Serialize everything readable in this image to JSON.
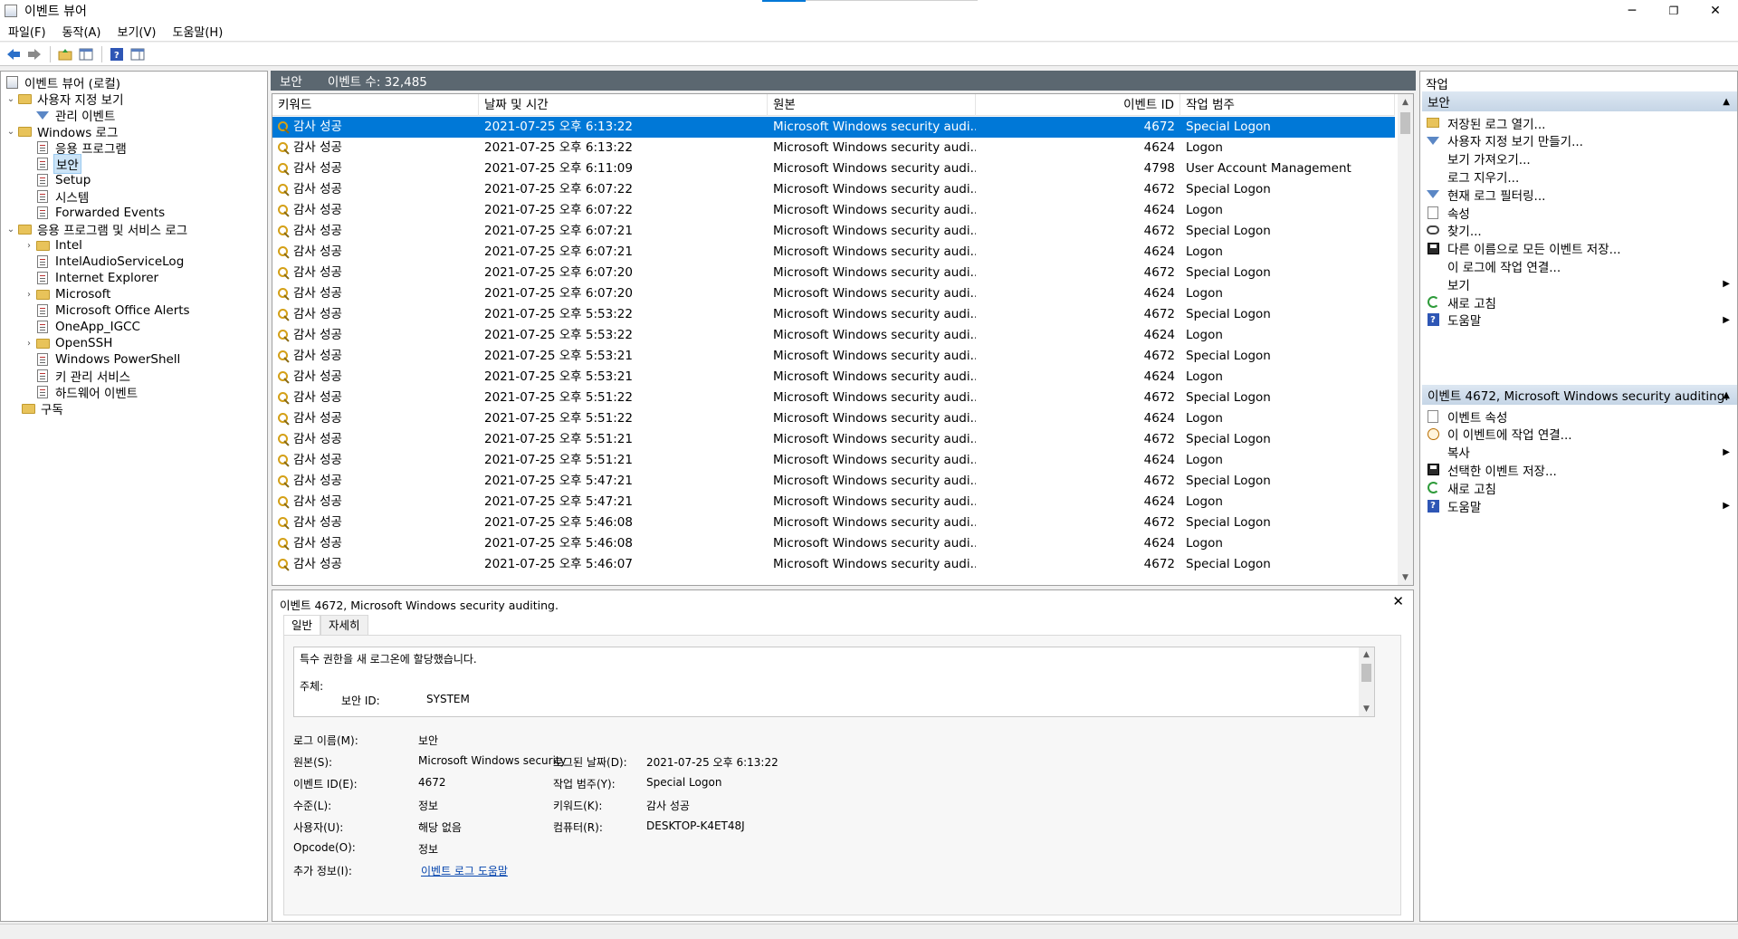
{
  "window": {
    "title": "이벤트 뷰어",
    "minimize": "─",
    "restore": "❐",
    "close": "✕"
  },
  "menu": [
    "파일(F)",
    "동작(A)",
    "보기(V)",
    "도움말(H)"
  ],
  "tree": {
    "root": "이벤트 뷰어 (로컬)",
    "custom_views": "사용자 지정 보기",
    "admin_events": "관리 이벤트",
    "windows_logs": "Windows 로그",
    "application": "응용 프로그램",
    "security": "보안",
    "setup": "Setup",
    "system": "시스템",
    "forwarded": "Forwarded Events",
    "app_service_logs": "응용 프로그램 및 서비스 로그",
    "intel": "Intel",
    "intel_audio": "IntelAudioServiceLog",
    "ie": "Internet Explorer",
    "microsoft": "Microsoft",
    "office_alerts": "Microsoft Office Alerts",
    "oneapp": "OneApp_IGCC",
    "openssh": "OpenSSH",
    "powershell": "Windows PowerShell",
    "key_mgmt": "키 관리 서비스",
    "hardware": "하드웨어 이벤트",
    "subscriptions": "구독"
  },
  "center": {
    "log_name": "보안",
    "event_count": "이벤트 수: 32,485"
  },
  "columns": {
    "keyword": "키워드",
    "datetime": "날짜 및 시간",
    "source": "원본",
    "event_id": "이벤트 ID",
    "category": "작업 범주"
  },
  "events": [
    {
      "kw": "감사 성공",
      "dt": "2021-07-25 오후 6:13:22",
      "src": "Microsoft Windows security audi...",
      "id": "4672",
      "cat": "Special Logon"
    },
    {
      "kw": "감사 성공",
      "dt": "2021-07-25 오후 6:13:22",
      "src": "Microsoft Windows security audi...",
      "id": "4624",
      "cat": "Logon"
    },
    {
      "kw": "감사 성공",
      "dt": "2021-07-25 오후 6:11:09",
      "src": "Microsoft Windows security audi...",
      "id": "4798",
      "cat": "User Account Management"
    },
    {
      "kw": "감사 성공",
      "dt": "2021-07-25 오후 6:07:22",
      "src": "Microsoft Windows security audi...",
      "id": "4672",
      "cat": "Special Logon"
    },
    {
      "kw": "감사 성공",
      "dt": "2021-07-25 오후 6:07:22",
      "src": "Microsoft Windows security audi...",
      "id": "4624",
      "cat": "Logon"
    },
    {
      "kw": "감사 성공",
      "dt": "2021-07-25 오후 6:07:21",
      "src": "Microsoft Windows security audi...",
      "id": "4672",
      "cat": "Special Logon"
    },
    {
      "kw": "감사 성공",
      "dt": "2021-07-25 오후 6:07:21",
      "src": "Microsoft Windows security audi...",
      "id": "4624",
      "cat": "Logon"
    },
    {
      "kw": "감사 성공",
      "dt": "2021-07-25 오후 6:07:20",
      "src": "Microsoft Windows security audi...",
      "id": "4672",
      "cat": "Special Logon"
    },
    {
      "kw": "감사 성공",
      "dt": "2021-07-25 오후 6:07:20",
      "src": "Microsoft Windows security audi...",
      "id": "4624",
      "cat": "Logon"
    },
    {
      "kw": "감사 성공",
      "dt": "2021-07-25 오후 5:53:22",
      "src": "Microsoft Windows security audi...",
      "id": "4672",
      "cat": "Special Logon"
    },
    {
      "kw": "감사 성공",
      "dt": "2021-07-25 오후 5:53:22",
      "src": "Microsoft Windows security audi...",
      "id": "4624",
      "cat": "Logon"
    },
    {
      "kw": "감사 성공",
      "dt": "2021-07-25 오후 5:53:21",
      "src": "Microsoft Windows security audi...",
      "id": "4672",
      "cat": "Special Logon"
    },
    {
      "kw": "감사 성공",
      "dt": "2021-07-25 오후 5:53:21",
      "src": "Microsoft Windows security audi...",
      "id": "4624",
      "cat": "Logon"
    },
    {
      "kw": "감사 성공",
      "dt": "2021-07-25 오후 5:51:22",
      "src": "Microsoft Windows security audi...",
      "id": "4672",
      "cat": "Special Logon"
    },
    {
      "kw": "감사 성공",
      "dt": "2021-07-25 오후 5:51:22",
      "src": "Microsoft Windows security audi...",
      "id": "4624",
      "cat": "Logon"
    },
    {
      "kw": "감사 성공",
      "dt": "2021-07-25 오후 5:51:21",
      "src": "Microsoft Windows security audi...",
      "id": "4672",
      "cat": "Special Logon"
    },
    {
      "kw": "감사 성공",
      "dt": "2021-07-25 오후 5:51:21",
      "src": "Microsoft Windows security audi...",
      "id": "4624",
      "cat": "Logon"
    },
    {
      "kw": "감사 성공",
      "dt": "2021-07-25 오후 5:47:21",
      "src": "Microsoft Windows security audi...",
      "id": "4672",
      "cat": "Special Logon"
    },
    {
      "kw": "감사 성공",
      "dt": "2021-07-25 오후 5:47:21",
      "src": "Microsoft Windows security audi...",
      "id": "4624",
      "cat": "Logon"
    },
    {
      "kw": "감사 성공",
      "dt": "2021-07-25 오후 5:46:08",
      "src": "Microsoft Windows security audi...",
      "id": "4672",
      "cat": "Special Logon"
    },
    {
      "kw": "감사 성공",
      "dt": "2021-07-25 오후 5:46:08",
      "src": "Microsoft Windows security audi...",
      "id": "4624",
      "cat": "Logon"
    },
    {
      "kw": "감사 성공",
      "dt": "2021-07-25 오후 5:46:07",
      "src": "Microsoft Windows security audi...",
      "id": "4672",
      "cat": "Special Logon"
    }
  ],
  "detail": {
    "title": "이벤트 4672, Microsoft Windows security auditing.",
    "close": "✕",
    "tab_general": "일반",
    "tab_details": "자세히",
    "desc_line1": "특수 권한을 새 로그온에 할당했습니다.",
    "desc_line2": "주체:",
    "desc_line3_label": "보안 ID:",
    "desc_line3_value": "SYSTEM",
    "labels": {
      "log_name": "로그 이름(M):",
      "source": "원본(S):",
      "event_id": "이벤트 ID(E):",
      "level": "수준(L):",
      "user": "사용자(U):",
      "opcode": "Opcode(O):",
      "more_info": "추가 정보(I):",
      "logged": "로그된 날짜(D):",
      "task_category": "작업 범주(Y):",
      "keywords": "키워드(K):",
      "computer": "컴퓨터(R):"
    },
    "values": {
      "log_name": "보안",
      "source": "Microsoft Windows security",
      "event_id": "4672",
      "level": "정보",
      "user": "해당 없음",
      "opcode": "정보",
      "more_info": "이벤트 로그 도움말",
      "logged": "2021-07-25 오후 6:13:22",
      "task_category": "Special Logon",
      "keywords": "감사 성공",
      "computer": "DESKTOP-K4ET48J"
    }
  },
  "actions": {
    "title": "작업",
    "section1": "보안",
    "items1": [
      {
        "label": "저장된 로그 열기...",
        "icon": "open-log-icon"
      },
      {
        "label": "사용자 지정 보기 만들기...",
        "icon": "filter-icon"
      },
      {
        "label": "보기 가져오기...",
        "icon": ""
      },
      {
        "label": "로그 지우기...",
        "icon": ""
      },
      {
        "label": "현재 로그 필터링...",
        "icon": "filter-icon"
      },
      {
        "label": "속성",
        "icon": "properties-icon"
      },
      {
        "label": "찾기...",
        "icon": "find-icon"
      },
      {
        "label": "다른 이름으로 모든 이벤트 저장...",
        "icon": "save-icon"
      },
      {
        "label": "이 로그에 작업 연결...",
        "icon": ""
      },
      {
        "label": "보기",
        "icon": ""
      },
      {
        "label": "새로 고침",
        "icon": "refresh-icon"
      },
      {
        "label": "도움말",
        "icon": "help-icon"
      }
    ],
    "section2": "이벤트 4672, Microsoft Windows security auditing.",
    "items2": [
      {
        "label": "이벤트 속성",
        "icon": "properties-icon"
      },
      {
        "label": "이 이벤트에 작업 연결...",
        "icon": "task-icon"
      },
      {
        "label": "복사",
        "icon": ""
      },
      {
        "label": "선택한 이벤트 저장...",
        "icon": "save-icon"
      },
      {
        "label": "새로 고침",
        "icon": "refresh-icon"
      },
      {
        "label": "도움말",
        "icon": "help-icon"
      }
    ]
  },
  "colors": {
    "selection": "#0078d7",
    "header_bar": "#5b6770",
    "section_header": "#c5d5e6"
  }
}
